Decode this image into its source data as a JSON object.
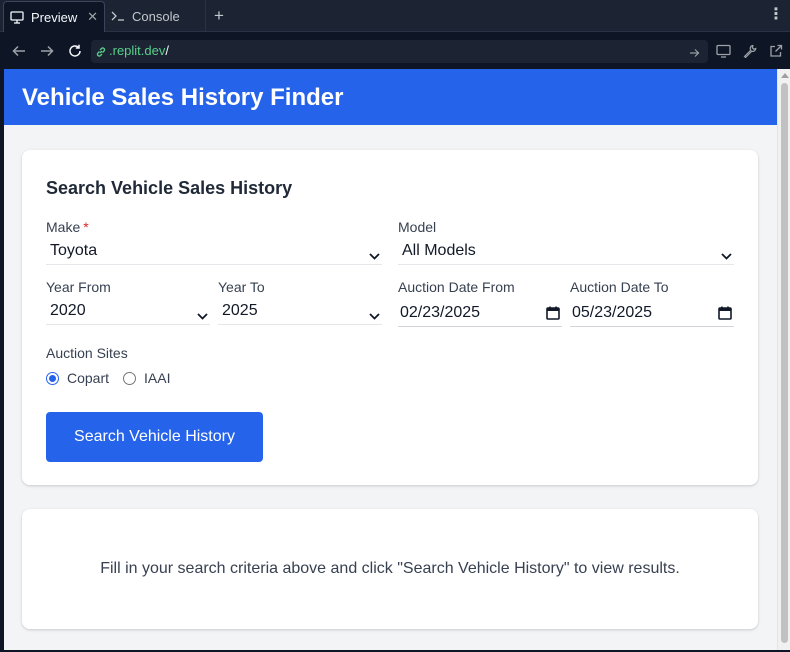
{
  "browser": {
    "tabs": [
      {
        "label": "Preview",
        "icon": "monitor-icon",
        "active": true
      },
      {
        "label": "Console",
        "icon": "terminal-icon",
        "active": false
      }
    ],
    "url": {
      "host": ".replit.dev",
      "path": "/"
    },
    "colors": {
      "chrome_bg": "#1c2333",
      "url_host": "#58d08a"
    }
  },
  "app": {
    "title": "Vehicle Sales History Finder",
    "colors": {
      "primary": "#2563eb",
      "page_bg": "#f3f4f6",
      "required": "#dc2626"
    }
  },
  "search_form": {
    "title": "Search Vehicle Sales History",
    "make": {
      "label": "Make",
      "required_mark": "*",
      "value": "Toyota"
    },
    "model": {
      "label": "Model",
      "value": "All Models"
    },
    "year_from": {
      "label": "Year From",
      "value": "2020"
    },
    "year_to": {
      "label": "Year To",
      "value": "2025"
    },
    "auction_date_from": {
      "label": "Auction Date From",
      "value": "02/23/2025"
    },
    "auction_date_to": {
      "label": "Auction Date To",
      "value": "05/23/2025"
    },
    "auction_sites": {
      "label": "Auction Sites",
      "options": [
        {
          "label": "Copart",
          "checked": true
        },
        {
          "label": "IAAI",
          "checked": false
        }
      ]
    },
    "submit_label": "Search Vehicle History"
  },
  "results": {
    "empty_message": "Fill in your search criteria above and click \"Search Vehicle History\" to view results."
  }
}
